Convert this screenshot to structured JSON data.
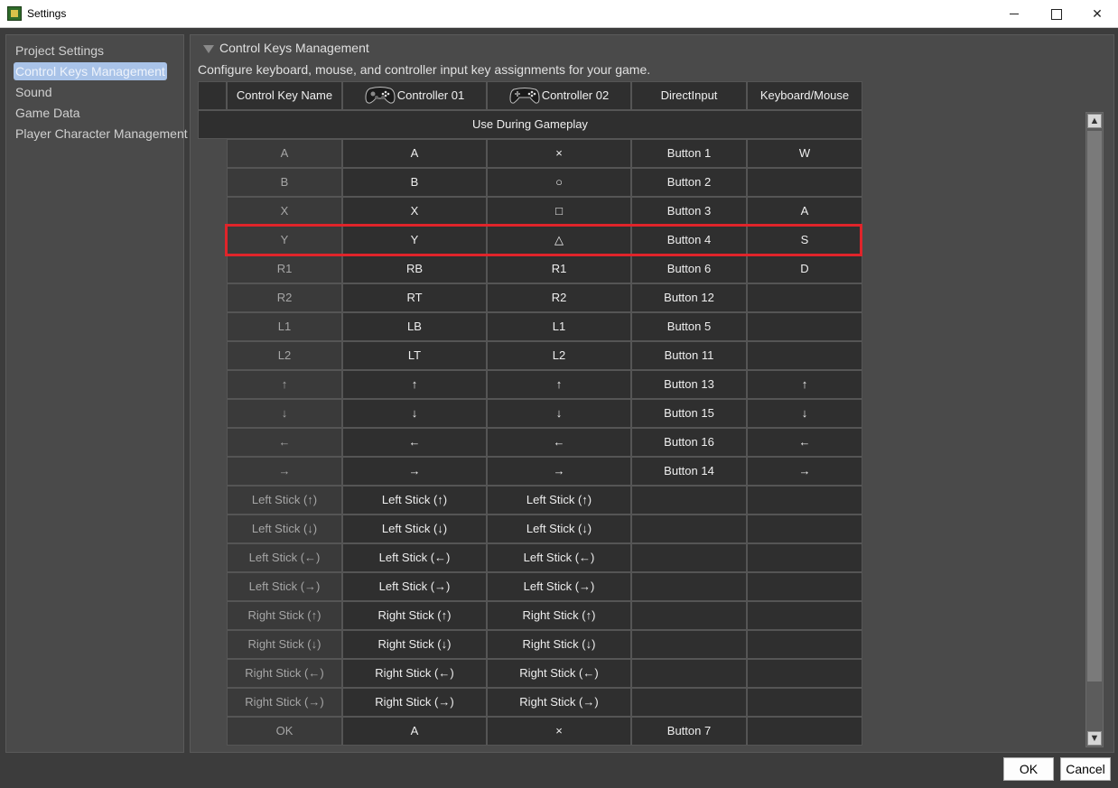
{
  "window": {
    "title": "Settings"
  },
  "sidebar": {
    "items": [
      {
        "label": "Project Settings"
      },
      {
        "label": "Control Keys Management"
      },
      {
        "label": "Sound"
      },
      {
        "label": "Game Data"
      },
      {
        "label": "Player Character Management"
      }
    ]
  },
  "main": {
    "section_title": "Control Keys Management",
    "description": "Configure keyboard, mouse, and controller input key assignments for your game.",
    "columns": [
      "Control Key Name",
      "Controller 01",
      "Controller 02",
      "DirectInput",
      "Keyboard/Mouse"
    ],
    "group_label": "Use During Gameplay",
    "highlighted_row": "Y",
    "rows": [
      [
        "A",
        "A",
        "×",
        "Button 1",
        "W"
      ],
      [
        "B",
        "B",
        "○",
        "Button 2",
        ""
      ],
      [
        "X",
        "X",
        "□",
        "Button 3",
        "A"
      ],
      [
        "Y",
        "Y",
        "△",
        "Button 4",
        "S"
      ],
      [
        "R1",
        "RB",
        "R1",
        "Button 6",
        "D"
      ],
      [
        "R2",
        "RT",
        "R2",
        "Button 12",
        ""
      ],
      [
        "L1",
        "LB",
        "L1",
        "Button 5",
        ""
      ],
      [
        "L2",
        "LT",
        "L2",
        "Button 11",
        ""
      ],
      [
        "↑",
        "↑",
        "↑",
        "Button 13",
        "↑"
      ],
      [
        "↓",
        "↓",
        "↓",
        "Button 15",
        "↓"
      ],
      [
        "←",
        "←",
        "←",
        "Button 16",
        "←"
      ],
      [
        "→",
        "→",
        "→",
        "Button 14",
        "→"
      ],
      [
        "Left Stick (↑)",
        "Left Stick (↑)",
        "Left Stick (↑)",
        "",
        ""
      ],
      [
        "Left Stick (↓)",
        "Left Stick (↓)",
        "Left Stick (↓)",
        "",
        ""
      ],
      [
        "Left Stick (←)",
        "Left Stick (←)",
        "Left Stick (←)",
        "",
        ""
      ],
      [
        "Left Stick (→)",
        "Left Stick (→)",
        "Left Stick (→)",
        "",
        ""
      ],
      [
        "Right Stick (↑)",
        "Right Stick (↑)",
        "Right Stick (↑)",
        "",
        ""
      ],
      [
        "Right Stick (↓)",
        "Right Stick (↓)",
        "Right Stick (↓)",
        "",
        ""
      ],
      [
        "Right Stick (←)",
        "Right Stick (←)",
        "Right Stick (←)",
        "",
        ""
      ],
      [
        "Right Stick (→)",
        "Right Stick (→)",
        "Right Stick (→)",
        "",
        ""
      ],
      [
        "OK",
        "A",
        "×",
        "Button 7",
        ""
      ]
    ]
  },
  "buttons": {
    "ok": "OK",
    "cancel": "Cancel"
  },
  "colors": {
    "highlight": "#e0242a",
    "selected_sidebar": "#a9c3e8"
  }
}
